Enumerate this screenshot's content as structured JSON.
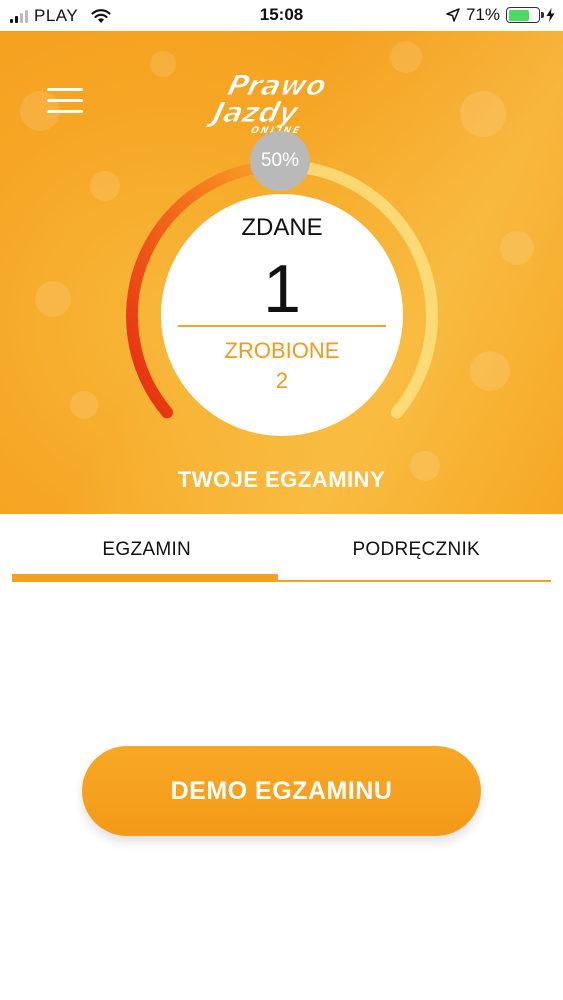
{
  "status_bar": {
    "carrier": "PLAY",
    "time": "15:08",
    "battery_percent": "71%",
    "battery_level": 0.71,
    "icons": [
      "signal-icon",
      "wifi-icon",
      "location-arrow-icon",
      "battery-icon",
      "charging-bolt-icon"
    ]
  },
  "header": {
    "logo_line1": "Prawo",
    "logo_line2": "Jazdy",
    "logo_line3": "ONLINE",
    "menu_icon": "hamburger-menu-icon"
  },
  "stats": {
    "percent": "50%",
    "percent_value": 0.5,
    "passed_label": "ZDANE",
    "passed_value": "1",
    "done_label": "ZROBIONE",
    "done_value": "2"
  },
  "section_title": "TWOJE EGZAMINY",
  "tabs": [
    {
      "label": "EGZAMIN",
      "active": true
    },
    {
      "label": "PODRĘCZNIK",
      "active": false
    }
  ],
  "demo_button_label": "DEMO EGZAMINU",
  "colors": {
    "accent": "#f6a120",
    "gauge_red": "#e83a12",
    "gauge_orange": "#f57f1e",
    "gauge_track": "#fde58a",
    "badge_gray": "#b9b9b9"
  }
}
